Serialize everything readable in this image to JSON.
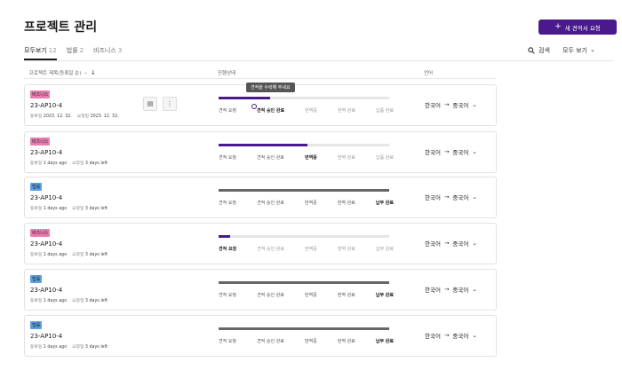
{
  "header": {
    "title": "프로젝트 관리",
    "new_button": "새 견적서 요청",
    "new_button_icon": "plus-icon"
  },
  "tabs": [
    {
      "label": "모두보기",
      "count": "12"
    },
    {
      "label": "법률",
      "count": "2"
    },
    {
      "label": "비즈니스",
      "count": "3"
    }
  ],
  "toolbar": {
    "search": "검색",
    "view": "모두 보기"
  },
  "columns": {
    "project": "프로젝트 제목(등록일 순)",
    "status": "진행상태",
    "language": "언어"
  },
  "colors": {
    "accent": "#4a1a8c",
    "biz_badge": "#e77fb0",
    "law_badge": "#5aa0e0",
    "complete": "#666666"
  },
  "tooltip": "견적을 수락해 주세요",
  "projects": [
    {
      "badge": "비즈니스",
      "code": "23-AP10-4",
      "reg_label": "등록일",
      "reg_value": "2023. 12. 32.",
      "req_label": "요청일",
      "req_value": "2023. 12. 32.",
      "progress": 0.3,
      "steps": [
        "견적 요청",
        "견적 승인 완료",
        "번역중",
        "번역 완료",
        "납품 완료"
      ],
      "current_step": 1,
      "src_lang": "한국어",
      "dst_lang": "중국어"
    },
    {
      "badge": "비즈니스",
      "code": "23-AP10-4",
      "reg_label": "등록일",
      "reg_value": "1 days ago",
      "req_label": "요청일",
      "req_value": "3 days left",
      "progress": 0.52,
      "steps": [
        "견적 요청",
        "견적 승인 완료",
        "번역중",
        "번역 완료",
        "납품 완료"
      ],
      "current_step": 2,
      "src_lang": "한국어",
      "dst_lang": "중국어"
    },
    {
      "badge": "법률",
      "code": "23-AP10-4",
      "reg_label": "등록일",
      "reg_value": "1 days ago",
      "req_label": "요청일",
      "req_value": "3 days left",
      "progress": 1.0,
      "steps": [
        "견적 요청",
        "견적 승인 완료",
        "번역중",
        "번역 완료",
        "납부 완료"
      ],
      "current_step": 4,
      "src_lang": "한국어",
      "dst_lang": "중국어"
    },
    {
      "badge": "비즈니스",
      "code": "23-AP10-4",
      "reg_label": "등록일",
      "reg_value": "1 days ago",
      "req_label": "요청일",
      "req_value": "3 days left",
      "progress": 0.07,
      "steps": [
        "견적 요청",
        "견적 승인 완료",
        "번역중",
        "번역 완료",
        "납부 완료"
      ],
      "current_step": 0,
      "src_lang": "한국어",
      "dst_lang": "중국어"
    },
    {
      "badge": "법률",
      "code": "23-AP10-4",
      "reg_label": "등록일",
      "reg_value": "1 days ago",
      "req_label": "요청일",
      "req_value": "3 days left",
      "progress": 1.0,
      "steps": [
        "견적 요청",
        "견적 승인 완료",
        "번역중",
        "번역 완료",
        "납부 완료"
      ],
      "current_step": 4,
      "src_lang": "한국어",
      "dst_lang": "중국어"
    },
    {
      "badge": "법률",
      "code": "23-AP10-4",
      "reg_label": "등록일",
      "reg_value": "1 days ago",
      "req_label": "요청일",
      "req_value": "3 days left",
      "progress": 1.0,
      "steps": [
        "견적 요청",
        "견적 승인 완료",
        "번역중",
        "번역 완료",
        "납부 완료"
      ],
      "current_step": 4,
      "src_lang": "한국어",
      "dst_lang": "중국어"
    }
  ]
}
